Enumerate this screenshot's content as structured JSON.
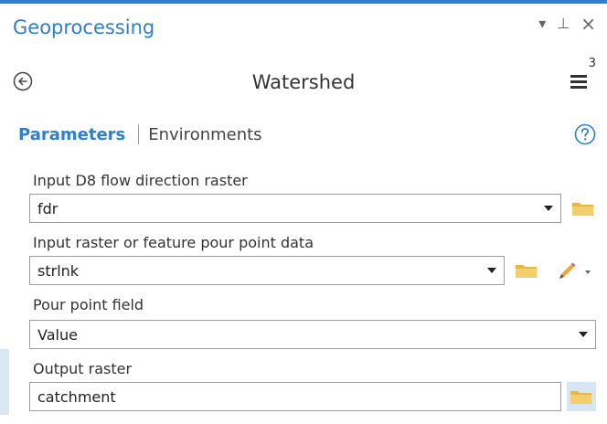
{
  "pane": {
    "title": "Geoprocessing",
    "controls": {
      "autohide": "▾",
      "pin": "⊥",
      "close": "×"
    }
  },
  "tool": {
    "title": "Watershed",
    "menu_badge": "3",
    "icons": {
      "back": "back-arrow-icon",
      "menu": "hamburger-menu-icon",
      "help": "help-icon"
    }
  },
  "tabs": [
    {
      "label": "Parameters",
      "active": true
    },
    {
      "label": "Environments",
      "active": false
    }
  ],
  "parameters": [
    {
      "label": "Input D8 flow direction raster",
      "value": "fdr",
      "type": "dropdown"
    },
    {
      "label": "Input raster or feature pour point data",
      "value": "strlnk",
      "type": "dropdown"
    },
    {
      "label": "Pour point field",
      "value": "Value",
      "type": "dropdown"
    },
    {
      "label": "Output raster",
      "value": "catchment",
      "type": "text"
    }
  ],
  "colors": {
    "accent": "#2f7fd1",
    "folder": "#e8b74a",
    "highlight": "#d6e6f6"
  }
}
